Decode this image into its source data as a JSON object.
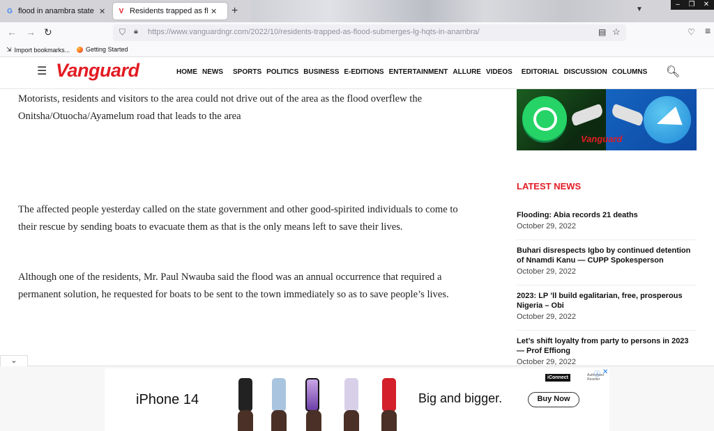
{
  "browser": {
    "tabs": [
      {
        "title": "flood in anambra state - Google",
        "active": false
      },
      {
        "title": "Residents trapped as flood subm",
        "active": true
      }
    ],
    "url_host": "https://www.vanguardngr.com",
    "url_path": "/2022/10/residents-trapped-as-flood-submerges-lg-hqts-in-anambra/",
    "bookmarks": [
      "Import bookmarks...",
      "Getting Started"
    ]
  },
  "site": {
    "logo": "Vanguard",
    "nav": [
      "HOME",
      "NEWS",
      "SPORTS",
      "POLITICS",
      "BUSINESS",
      "E-EDITIONS",
      "ENTERTAINMENT",
      "ALLURE",
      "VIDEOS",
      "EDITORIAL",
      "DISCUSSION",
      "COLUMNS"
    ]
  },
  "article": {
    "paragraphs": [
      "Motorists, residents and visitors to the area could not drive out of the area as the flood overflew the Onitsha/Otuocha/Ayamelum road that leads to the area",
      "The affected people yesterday called on the state government and other good-spirited individuals to come to their rescue by sending boats to evacuate them as that is the only means left to save their lives.",
      "Although one of the residents, Mr. Paul Nwauba said the flood was an annual occurrence that required a permanent solution,  he requested for boats to be sent to the town immediately so as to save people’s lives."
    ]
  },
  "sidebar": {
    "promo_label": "Vanguard",
    "latest_title": "LATEST NEWS",
    "news": [
      {
        "headline": "Flooding: Abia records 21 deaths",
        "date": "October 29, 2022"
      },
      {
        "headline": "Buhari disrespects Igbo by continued detention of Nnamdi Kanu — CUPP Spokesperson",
        "date": "October 29, 2022"
      },
      {
        "headline": "2023: LP ’ll build egalitarian, free, prosperous Nigeria – Obi",
        "date": "October 29, 2022"
      },
      {
        "headline": "Let’s shift loyalty from party to persons in 2023 — Prof Effiong",
        "date": "October 29, 2022"
      }
    ]
  },
  "ad": {
    "product": "iPhone 14",
    "tagline": "Big and bigger.",
    "cta": "Buy Now",
    "reseller": "iConnect",
    "reseller_note": "Authorised Reseller"
  }
}
